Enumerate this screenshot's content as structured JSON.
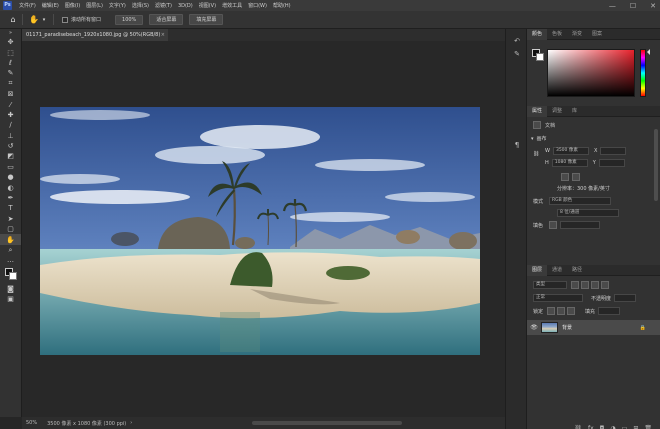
{
  "menubar": {
    "logo_text": "Ps",
    "items": [
      "文件(F)",
      "编辑(E)",
      "图像(I)",
      "图层(L)",
      "文字(Y)",
      "选择(S)",
      "滤镜(T)",
      "3D(D)",
      "视图(V)",
      "增效工具",
      "窗口(W)",
      "帮助(H)"
    ],
    "window_controls": [
      "—",
      "☐",
      "✕"
    ]
  },
  "optionsbar": {
    "scroll_all_windows": "滚动所有窗口",
    "zoom_value": "100%",
    "fit_screen": "适合屏幕",
    "fill_screen": "填充屏幕"
  },
  "document": {
    "tab_title": "01171_paradisebeach_1920x1080.jpg @ 50%(RGB/8)",
    "zoom": "50%",
    "info": "3500 像素 x 1080 像素 (300 ppi)"
  },
  "panels": {
    "color_tabs": [
      "颜色",
      "色板",
      "渐变",
      "图案"
    ],
    "props_tabs": [
      "属性",
      "调整",
      "库"
    ],
    "props": {
      "type_label": "文档",
      "canvas_label": "画布",
      "w_label": "W",
      "w_value": "3500 像素",
      "x_label": "X",
      "h_label": "H",
      "h_value": "1080 像素",
      "y_label": "Y",
      "resolution": "分辨率：300 像素/英寸",
      "mode_label": "模式",
      "mode_value": "RGB 颜色",
      "depth_value": "8 位/通道",
      "fill_label": "填色"
    },
    "layers_tabs": [
      "图层",
      "通道",
      "路径"
    ],
    "layers": {
      "kind_placeholder": "类型",
      "blend_mode": "正常",
      "opacity_label": "不透明度",
      "lock_label": "锁定",
      "fill_label": "填充",
      "layer_name": "背景",
      "lock_icon": "🔒"
    }
  },
  "colors": {
    "accent": "#2b4ea8",
    "panel_bg": "#323232",
    "canvas_bg": "#282828",
    "foreground": "#111111",
    "background": "#ffffff"
  }
}
